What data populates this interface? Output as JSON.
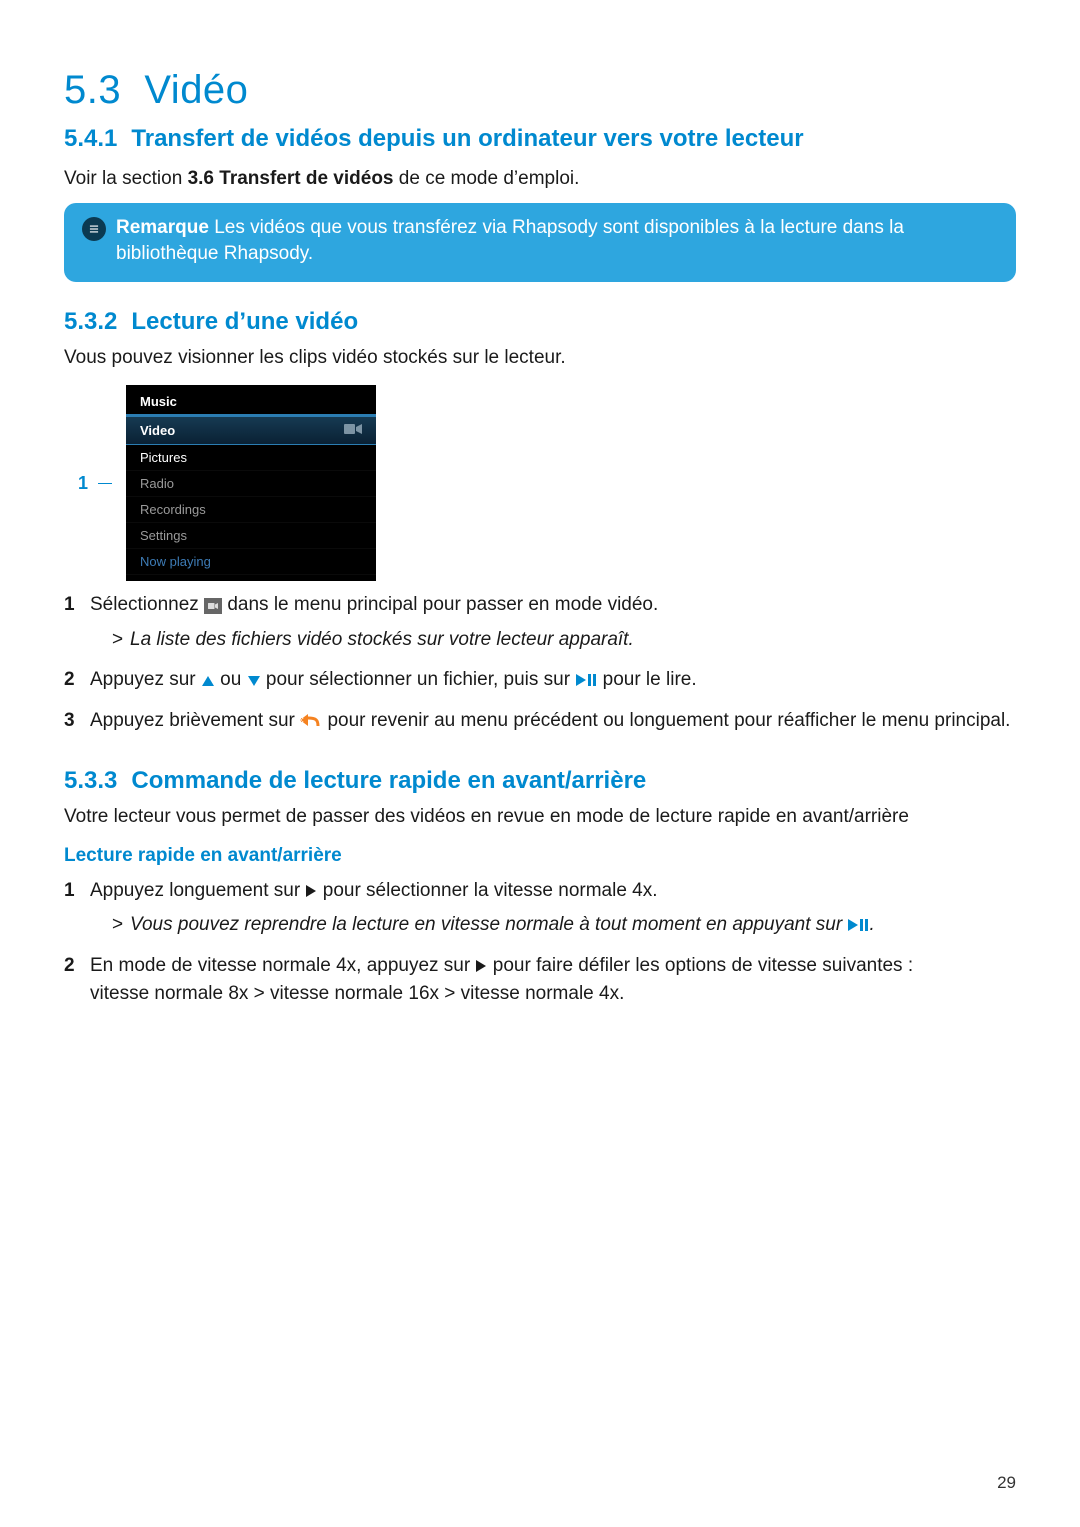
{
  "page_number": "29",
  "h1": {
    "num": "5.3",
    "title": "Vidéo"
  },
  "h2_541": {
    "num": "5.4.1",
    "title": "Transfert de vidéos depuis un ordinateur vers votre lecteur"
  },
  "p_see_section_pre": "Voir la section ",
  "p_see_section_bold": "3.6 Transfert de vidéos",
  "p_see_section_post": " de ce mode d’emploi.",
  "note": {
    "label": "Remarque",
    "text": " Les vidéos que vous transférez via Rhapsody sont disponibles à la lecture dans la bibliothèque Rhapsody."
  },
  "h2_532": {
    "num": "5.3.2",
    "title": "Lecture d’une vidéo"
  },
  "p_532": "Vous pouvez visionner les clips vidéo stockés sur le lecteur.",
  "device_callout": "1",
  "device_menu": {
    "music": "Music",
    "video": "Video",
    "pictures": "Pictures",
    "radio": "Radio",
    "recordings": "Recordings",
    "settings": "Settings",
    "now_playing": "Now playing"
  },
  "steps_532": {
    "s1_pre": "Sélectionnez ",
    "s1_post": " dans le menu principal pour passer en mode vidéo.",
    "s1_result": "La liste des fichiers vidéo stockés sur votre lecteur apparaît.",
    "s2_pre": "Appuyez sur ",
    "s2_mid": " ou ",
    "s2_mid2": " pour sélectionner un fichier, puis sur ",
    "s2_post": " pour le lire.",
    "s3_pre": "Appuyez brièvement sur ",
    "s3_post": " pour revenir au menu précédent ou longuement pour réafficher le menu principal."
  },
  "h2_533": {
    "num": "5.3.3",
    "title": "Commande de lecture rapide en avant/arrière"
  },
  "p_533": "Votre lecteur vous permet de passer des vidéos en revue en mode de lecture rapide en avant/arrière",
  "h4_533a": "Lecture rapide en avant/arrière",
  "steps_533": {
    "s1_pre": "Appuyez longuement sur ",
    "s1_post": " pour sélectionner la vitesse normale 4x.",
    "s1_result_pre": "Vous pouvez reprendre la lecture en vitesse normale à tout moment en appuyant sur ",
    "s1_result_post": ".",
    "s2_pre": "En mode de vitesse normale 4x, appuyez sur ",
    "s2_post": " pour faire défiler les options de vitesse suivantes :",
    "s2_line2": "vitesse normale 8x > vitesse normale 16x > vitesse normale 4x."
  }
}
